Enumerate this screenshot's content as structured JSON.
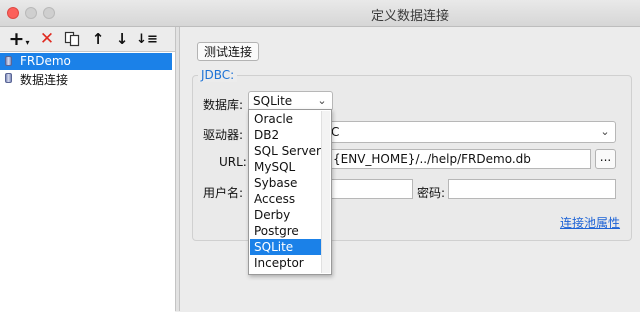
{
  "window": {
    "title": "定义数据连接"
  },
  "toolbar": {
    "add": "+",
    "add_caret": "▾",
    "delete": "✕",
    "up": "↑",
    "down": "↓",
    "sort": "↓≡"
  },
  "tree": {
    "items": [
      {
        "label": "FRDemo",
        "selected": true
      },
      {
        "label": "数据连接",
        "selected": false
      }
    ]
  },
  "form": {
    "test_button": "测试连接",
    "group_title": "JDBC:",
    "database_label": "数据库:",
    "database_value": "SQLite",
    "driver_label": "驱动器:",
    "driver_value_visible": "C",
    "url_label": "URL:",
    "url_value_visible": "{ENV_HOME}/../help/FRDemo.db",
    "browse_label": "...",
    "username_label": "用户名:",
    "username_value": "",
    "password_label": "密码:",
    "password_value": "",
    "pool_link": "连接池属性"
  },
  "dropdown": {
    "options": [
      "Oracle",
      "DB2",
      "SQL Server",
      "MySQL",
      "Sybase",
      "Access",
      "Derby",
      "Postgre",
      "SQLite",
      "Inceptor"
    ],
    "selected": "SQLite"
  },
  "colors": {
    "selection": "#1b81e8",
    "link": "#1d63d6",
    "delete_icon": "#e02a20"
  }
}
